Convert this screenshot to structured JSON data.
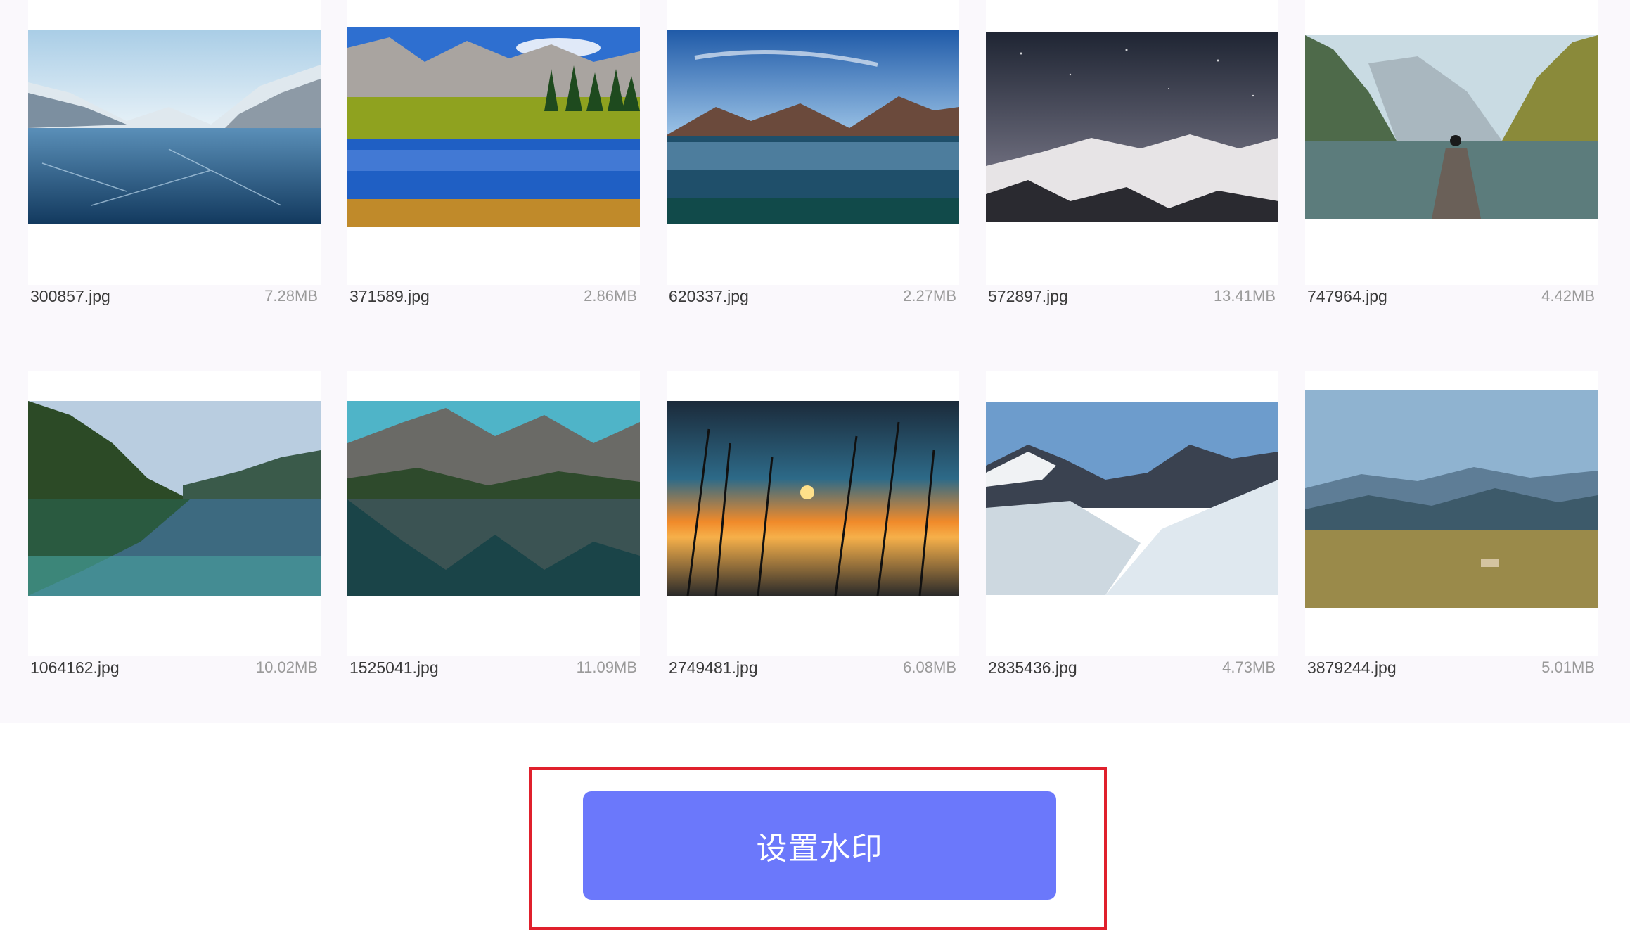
{
  "gallery": {
    "items": [
      {
        "name": "300857.jpg",
        "size": "7.28MB"
      },
      {
        "name": "371589.jpg",
        "size": "2.86MB"
      },
      {
        "name": "620337.jpg",
        "size": "2.27MB"
      },
      {
        "name": "572897.jpg",
        "size": "13.41MB"
      },
      {
        "name": "747964.jpg",
        "size": "4.42MB"
      },
      {
        "name": "1064162.jpg",
        "size": "10.02MB"
      },
      {
        "name": "1525041.jpg",
        "size": "11.09MB"
      },
      {
        "name": "2749481.jpg",
        "size": "6.08MB"
      },
      {
        "name": "2835436.jpg",
        "size": "4.73MB"
      },
      {
        "name": "3879244.jpg",
        "size": "5.01MB"
      }
    ]
  },
  "actions": {
    "set_watermark_label": "设置水印"
  },
  "colors": {
    "accent": "#6b78fb",
    "highlight": "#e0202c",
    "gallery_bg": "#faf8fc"
  }
}
